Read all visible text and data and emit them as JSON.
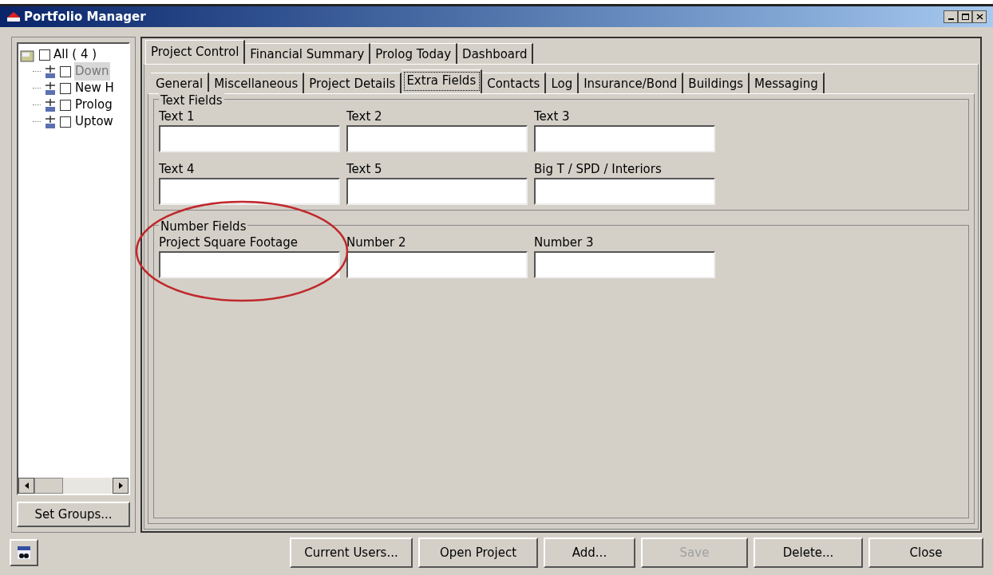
{
  "window": {
    "title": "Portfolio Manager"
  },
  "tree": {
    "label": "All ( 4 )",
    "checked": false,
    "children": [
      {
        "label": "Down",
        "checked": false,
        "selected": true
      },
      {
        "label": "New H",
        "checked": false,
        "selected": false
      },
      {
        "label": "Prolog",
        "checked": false,
        "selected": false
      },
      {
        "label": "Uptow",
        "checked": false,
        "selected": false
      }
    ]
  },
  "set_groups_button": "Set Groups...",
  "tabs": [
    {
      "label": "Project Control",
      "selected": true
    },
    {
      "label": "Financial Summary",
      "selected": false
    },
    {
      "label": "Prolog Today",
      "selected": false
    },
    {
      "label": "Dashboard",
      "selected": false
    }
  ],
  "subtabs": [
    {
      "label": "General",
      "selected": false
    },
    {
      "label": "Miscellaneous",
      "selected": false
    },
    {
      "label": "Project Details",
      "selected": false
    },
    {
      "label": "Extra Fields",
      "selected": true
    },
    {
      "label": "Contacts",
      "selected": false
    },
    {
      "label": "Log",
      "selected": false
    },
    {
      "label": "Insurance/Bond",
      "selected": false
    },
    {
      "label": "Buildings",
      "selected": false
    },
    {
      "label": "Messaging",
      "selected": false
    }
  ],
  "groups": [
    {
      "title": "Text Fields",
      "fields": [
        {
          "label": "Text 1"
        },
        {
          "label": "Text 2"
        },
        {
          "label": "Text 3"
        },
        {
          "label": "Text 4"
        },
        {
          "label": "Text 5"
        },
        {
          "label": "Big T / SPD / Interiors"
        }
      ]
    },
    {
      "title": "Number Fields",
      "highlighted": true,
      "fields": [
        {
          "label": "Project Square Footage"
        },
        {
          "label": "Number 2"
        },
        {
          "label": "Number 3"
        }
      ]
    }
  ],
  "buttons": [
    {
      "label": "Current Users...",
      "disabled": false
    },
    {
      "label": "Open Project",
      "disabled": false
    },
    {
      "label": "Add...",
      "disabled": false
    },
    {
      "label": "Save",
      "disabled": true
    },
    {
      "label": "Delete...",
      "disabled": false
    },
    {
      "label": "Close",
      "disabled": false
    }
  ]
}
